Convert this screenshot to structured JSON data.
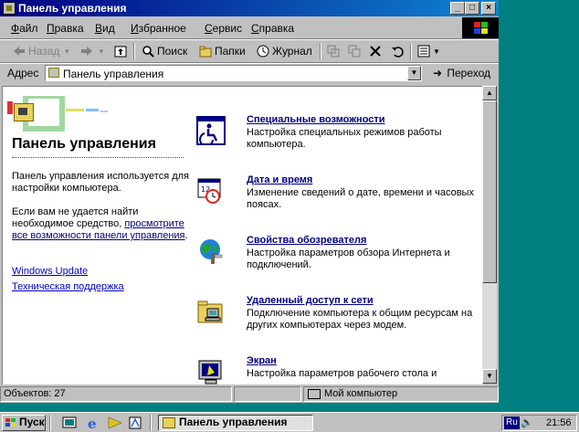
{
  "window": {
    "title": "Панель управления",
    "controls": {
      "minimize": "_",
      "maximize": "□",
      "close": "×"
    }
  },
  "menu": [
    {
      "u": "Ф",
      "rest": "айл"
    },
    {
      "u": "П",
      "rest": "равка"
    },
    {
      "u": "В",
      "rest": "ид"
    },
    {
      "u": "И",
      "rest": "збранное"
    },
    {
      "u": "С",
      "rest": "ервис"
    },
    {
      "u": "С",
      "rest": "правка"
    }
  ],
  "toolbar": {
    "back": "Назад",
    "search": "Поиск",
    "folders": "Папки",
    "history": "Журнал"
  },
  "address": {
    "label": "Адрес",
    "value": "Панель управления",
    "go": "Переход"
  },
  "sidebar": {
    "title": "Панель управления",
    "intro": "Панель управления используется для настройки компьютера.",
    "not_found": "Если вам не удается найти необходимое средство,",
    "see_all_link": "просмотрите все возможности панели управления",
    "see_all_tail": ".",
    "links": [
      "Windows Update",
      "Техническая поддержка"
    ]
  },
  "items": [
    {
      "title": "Специальные возможности",
      "desc": "Настройка специальных режимов работы компьютера.",
      "icon": "accessibility-icon"
    },
    {
      "title": "Дата и время",
      "desc": "Изменение сведений о дате, времени и часовых поясах.",
      "icon": "date-time-icon"
    },
    {
      "title": "Свойства обозревателя",
      "desc": "Настройка параметров обзора Интернета и подключений.",
      "icon": "internet-options-icon"
    },
    {
      "title": "Удаленный доступ к сети",
      "desc": "Подключение компьютера к общим ресурсам на других компьютерах через модем.",
      "icon": "dialup-network-icon"
    },
    {
      "title": "Экран",
      "desc": "Настройка параметров рабочего стола и",
      "icon": "display-icon"
    }
  ],
  "status": {
    "objects": "Объектов: 27",
    "zone": "Мой компьютер"
  },
  "taskbar": {
    "start": "Пуск",
    "task": "Панель управления",
    "lang": "Ru",
    "clock": "21:56"
  }
}
